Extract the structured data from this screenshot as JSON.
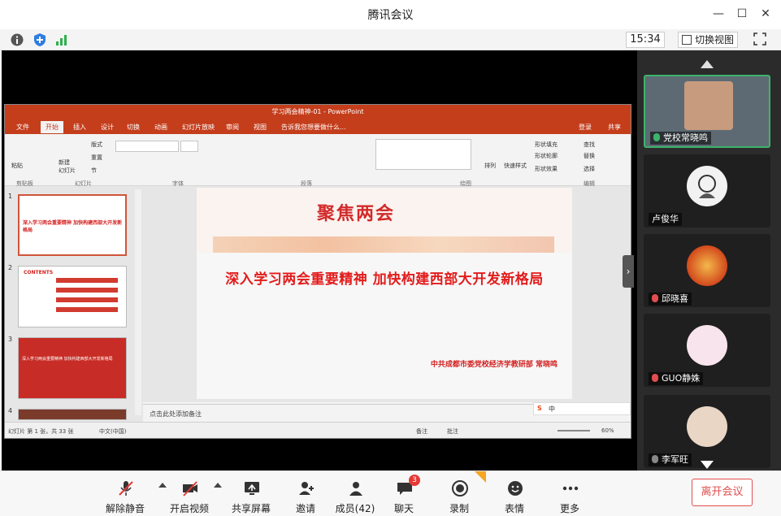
{
  "app": {
    "title": "腾讯会议"
  },
  "window_controls": [
    "minimize",
    "maximize",
    "close"
  ],
  "statusbar": {
    "time": "15:34",
    "switch_view_label": "切换视图"
  },
  "ppt": {
    "title": "学习两会精神-01 - PowerPoint",
    "menu": [
      "文件",
      "开始",
      "插入",
      "设计",
      "切换",
      "动画",
      "幻灯片放映",
      "审阅",
      "视图"
    ],
    "active_tab": "开始",
    "tell_me": "告诉我您想要做什么...",
    "login": "登录",
    "share": "共享",
    "ribbon_groups": [
      "剪贴板",
      "幻灯片",
      "字体",
      "段落",
      "绘图",
      "编辑"
    ],
    "ribbon_buttons": {
      "paste": "粘贴",
      "new_slide": "新建\n幻灯片",
      "layout": "版式",
      "reset": "重置",
      "section": "节",
      "arrange": "排列",
      "quick_styles": "快速样式",
      "shape_fill": "形状填充",
      "shape_outline": "形状轮廓",
      "shape_effects": "形状效果",
      "find": "查找",
      "replace": "替换",
      "select": "选择"
    },
    "thumbnails": [
      "1",
      "2",
      "3",
      "4"
    ],
    "thumb_texts": {
      "t1": "深入学习两会重要精神 加快构建西部大开发新格局",
      "t2": "CONTENTS",
      "t3": "深入学习两会重要精神 加快构建西部大开发新格局"
    },
    "slide": {
      "logo": "聚焦两会",
      "headline": "深入学习两会重要精神  加快构建西部大开发新格局",
      "byline": "中共成都市委党校经济学教研部  常晓鸣"
    },
    "notes_placeholder": "点击此处添加备注",
    "status": {
      "slide_count": "幻灯片 第 1 张，共 33 张",
      "language": "中文(中国)",
      "notes": "备注",
      "comments": "批注",
      "zoom": "60%"
    }
  },
  "participants": [
    {
      "name": "党校常晓鸣",
      "active": true
    },
    {
      "name": "卢俊华",
      "active": false
    },
    {
      "name": "邱晓喜",
      "active": false
    },
    {
      "name": "GUO静姝",
      "active": false
    },
    {
      "name": "李军旺",
      "active": false
    }
  ],
  "toolbar": {
    "unmute": "解除静音",
    "start_video": "开启视频",
    "share_screen": "共享屏幕",
    "invite": "邀请",
    "members": "成员(42)",
    "chat": "聊天",
    "chat_badge": "3",
    "record": "录制",
    "emoji": "表情",
    "more": "更多",
    "leave": "离开会议"
  },
  "colors": {
    "accent_red": "#e34d4d",
    "ppt_red": "#c43e1c",
    "active_green": "#3db36b"
  }
}
